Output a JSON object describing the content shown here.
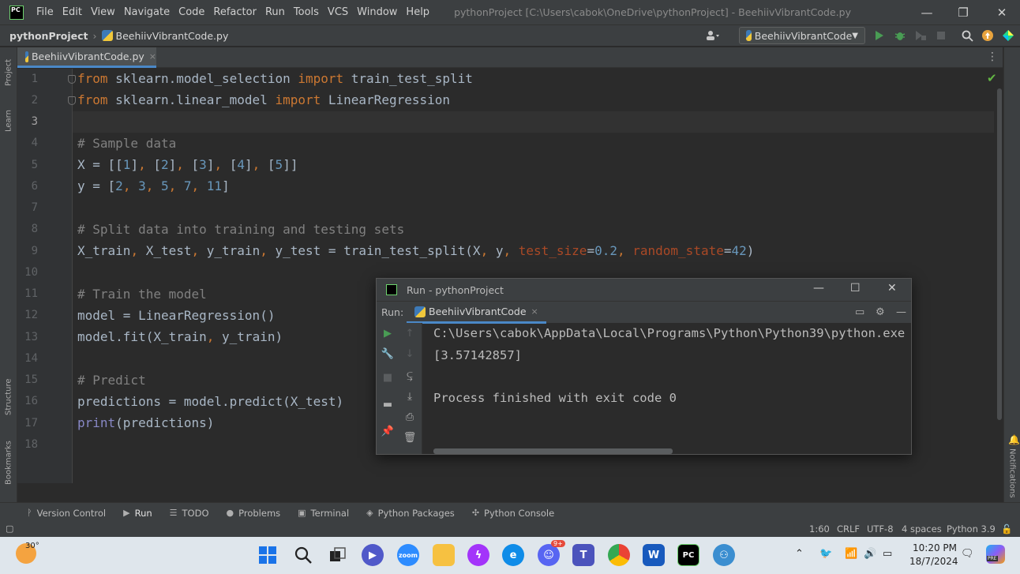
{
  "menubar": {
    "items": [
      "File",
      "Edit",
      "View",
      "Navigate",
      "Code",
      "Refactor",
      "Run",
      "Tools",
      "VCS",
      "Window",
      "Help"
    ],
    "underline": [
      "F",
      "E",
      "V",
      "N",
      "C",
      "R",
      "R",
      "T",
      "S",
      "W",
      "H"
    ],
    "window_title": "pythonProject [C:\\Users\\cabok\\OneDrive\\pythonProject] - BeehiivVibrantCode.py",
    "minimize": "—",
    "restore": "❐",
    "close": "✕"
  },
  "navbar": {
    "project": "pythonProject",
    "separator": "›",
    "file": "BeehiivVibrantCode.py",
    "run_config": "BeehiivVibrantCode"
  },
  "left_strip": {
    "project": "Project",
    "learn": "Learn",
    "structure": "Structure",
    "bookmarks": "Bookmarks"
  },
  "right_strip": {
    "notifications": "Notifications"
  },
  "editor": {
    "tab_name": "BeehiivVibrantCode.py",
    "tab_close": "×",
    "line_numbers": [
      "1",
      "2",
      "3",
      "4",
      "5",
      "6",
      "7",
      "8",
      "9",
      "10",
      "11",
      "12",
      "13",
      "14",
      "15",
      "16",
      "17",
      "18"
    ],
    "lines": {
      "l1": {
        "kw1": "from",
        "mod": " sklearn.model_selection ",
        "kw2": "import",
        "name": " train_test_split"
      },
      "l2": {
        "kw1": "from",
        "mod": " sklearn.linear_model ",
        "kw2": "import",
        "name": " LinearRegression"
      },
      "l4": "# Sample data",
      "l5": {
        "a": "X = [[",
        "n1": "1",
        "b": "]",
        "c1": ", ",
        "d": "[",
        "n2": "2",
        "e": "]",
        "c2": ", ",
        "f": "[",
        "n3": "3",
        "g": "]",
        "c3": ", ",
        "h": "[",
        "n4": "4",
        "i": "]",
        "c4": ", ",
        "j": "[",
        "n5": "5",
        "k": "]]"
      },
      "l6": {
        "a": "y = [",
        "n1": "2",
        "c1": ", ",
        "n2": "3",
        "c2": ", ",
        "n3": "5",
        "c3": ", ",
        "n4": "7",
        "c4": ", ",
        "n5": "11",
        "b": "]"
      },
      "l8": "# Split data into training and testing sets",
      "l9": {
        "a": "X_train",
        "c1": ", ",
        "b": "X_test",
        "c2": ", ",
        "c": "y_train",
        "c3": ", ",
        "d": "y_test = train_test_split(X",
        "c4": ", ",
        "e": "y",
        "c5": ", ",
        "p1": "test_size",
        "eq1": "=",
        "n1": "0.2",
        "c6": ", ",
        "p2": "random_state",
        "eq2": "=",
        "n2": "42",
        "f": ")"
      },
      "l11": "# Train the model",
      "l12": "model = LinearRegression()",
      "l13": {
        "a": "model.fit(X_train",
        "c": ", ",
        "b": "y_train)"
      },
      "l15": "# Predict",
      "l16": "predictions = model.predict(X_test)",
      "l17": {
        "fn": "print",
        "rest": "(predictions)"
      }
    }
  },
  "run_window": {
    "title": "Run - pythonProject",
    "label": "Run:",
    "tab": "BeehiivVibrantCode",
    "tab_close": "×",
    "output": [
      "C:\\Users\\cabok\\AppData\\Local\\Programs\\Python\\Python39\\python.exe",
      "[3.57142857]",
      "",
      "Process finished with exit code 0"
    ]
  },
  "bottom_tools": [
    {
      "icon": "ᚹ",
      "label": "Version Control"
    },
    {
      "icon": "▶",
      "label": "Run"
    },
    {
      "icon": "☰",
      "label": "TODO"
    },
    {
      "icon": "●",
      "label": "Problems"
    },
    {
      "icon": "▣",
      "label": "Terminal"
    },
    {
      "icon": "◈",
      "label": "Python Packages"
    },
    {
      "icon": "✣",
      "label": "Python Console"
    }
  ],
  "statusbar": {
    "position": "1:60",
    "line_sep": "CRLF",
    "encoding": "UTF-8",
    "indent": "4 spaces",
    "interpreter": "Python 3.9"
  },
  "taskbar": {
    "temperature": "30°",
    "time": "10:20 PM",
    "date": "18/7/2024",
    "badge": "9+",
    "copilot": "PRE"
  },
  "colors": {
    "keyword": "#cc7832",
    "comment": "#808080",
    "number": "#6897bb",
    "param": "#aa4926",
    "accent": "#4a88c7",
    "run_green": "#499c54"
  }
}
